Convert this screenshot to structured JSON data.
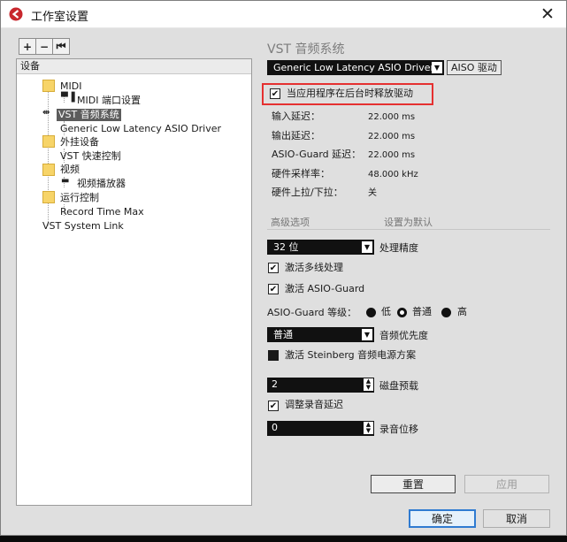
{
  "window": {
    "title": "工作室设置",
    "close_symbol": "✕"
  },
  "toolbar": {
    "add": "+",
    "remove": "−",
    "reset": "⏮"
  },
  "tree": {
    "header": "设备",
    "items": [
      {
        "label": "MIDI"
      },
      {
        "label": "MIDI 端口设置"
      },
      {
        "label": "VST 音频系统"
      },
      {
        "label": "Generic Low Latency ASIO Driver"
      },
      {
        "label": "外挂设备"
      },
      {
        "label": "VST 快速控制"
      },
      {
        "label": "视频"
      },
      {
        "label": "视频播放器"
      },
      {
        "label": "运行控制"
      },
      {
        "label": "Record Time Max"
      },
      {
        "label": "VST System Link"
      }
    ]
  },
  "panel": {
    "title": "VST 音频系统",
    "driver_select": "Generic Low Latency ASIO Driver",
    "asio_button": "AISO 驱动",
    "release_driver_label": "当应用程序在后台时释放驱动",
    "release_driver_checked": true,
    "info": [
      {
        "label": "输入延迟：",
        "value": "22.000 ms"
      },
      {
        "label": "输出延迟：",
        "value": "22.000 ms"
      },
      {
        "label": "ASIO-Guard 延迟：",
        "value": "22.000 ms"
      },
      {
        "label": "硬件采样率：",
        "value": "48.000 kHz"
      },
      {
        "label": "硬件上拉/下拉：",
        "value": "关"
      }
    ],
    "advanced_label": "高级选项",
    "set_default_label": "设置为默认",
    "precision_select": "32 位",
    "precision_label": "处理精度",
    "multi_proc_label": "激活多线处理",
    "multi_proc_checked": true,
    "asio_guard_label": "激活 ASIO-Guard",
    "asio_guard_checked": true,
    "guard_level_label": "ASIO-Guard 等级：",
    "guard_levels": [
      "低",
      "普通",
      "高"
    ],
    "guard_level_selected": "普通",
    "priority_select": "普通",
    "priority_label": "音频优先度",
    "power_scheme_label": "激活 Steinberg 音频电源方案",
    "power_scheme_checked": false,
    "disk_preload_value": "2",
    "disk_preload_label": "磁盘预载",
    "adjust_latency_label": "调整录音延迟",
    "adjust_latency_checked": true,
    "record_offset_value": "0",
    "record_offset_label": "录音位移",
    "reset_button": "重置",
    "apply_button": "应用"
  },
  "footer": {
    "ok": "确定",
    "cancel": "取消"
  }
}
